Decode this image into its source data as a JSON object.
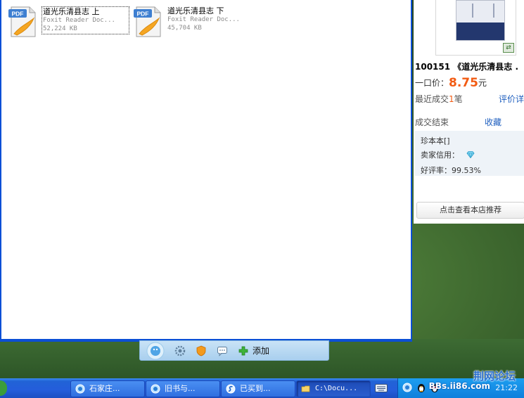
{
  "explorer": {
    "files": [
      {
        "name": "道光乐清县志 上",
        "type": "Foxit Reader Doc...",
        "size": "52,224 KB",
        "icon": "pdf-file-icon"
      },
      {
        "name": "道光乐清县志 下",
        "type": "Foxit Reader Doc...",
        "size": "45,704 KB",
        "icon": "pdf-file-icon"
      }
    ],
    "pdf_badge": "PDF"
  },
  "shop": {
    "title": "100151 《道光乐清县志 .",
    "price_label": "一口价：",
    "price": "8.75",
    "price_unit": "元",
    "recent_label": "最近成交",
    "recent_count": "1",
    "recent_unit": "笔",
    "rate_link": "评价详",
    "status": "成交结束",
    "favorite": "收藏",
    "seller_rows": {
      "edition": "珍本本[]",
      "credit": "卖家信用：",
      "good_rate": "好评率：99.53%"
    },
    "recommend_button": "点击查看本店推荐",
    "colors": {
      "price": "#f25b13",
      "link": "#1f5fbf"
    }
  },
  "float_bar": {
    "add_label": "添加"
  },
  "taskbar": {
    "buttons": [
      {
        "label": "石家庄...",
        "icon": "qq-chat-icon"
      },
      {
        "label": "旧书与...",
        "icon": "qq-chat-icon"
      },
      {
        "label": "已买到...",
        "icon": "browser-icon"
      },
      {
        "label": "C:\\Docu...",
        "icon": "folder-icon"
      }
    ],
    "clock": "21:22"
  },
  "watermark": {
    "title": "荆网论坛",
    "url": "BBs.ii86.com"
  }
}
